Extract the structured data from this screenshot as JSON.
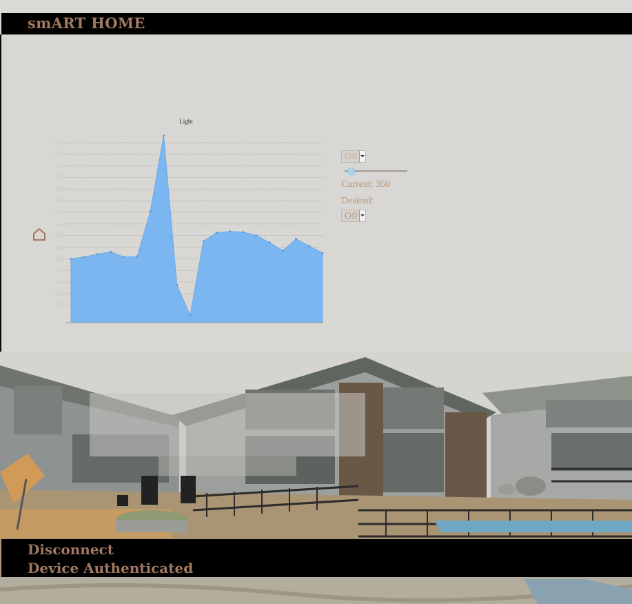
{
  "header": {
    "brand": "smART HOME"
  },
  "icons": {
    "home": "home-icon"
  },
  "colors": {
    "brand_text": "#a0785f",
    "header_bg": "#000000",
    "page_bg": "#d9d7d3",
    "area_fill": "#7cb6f1",
    "control_text": "#b49478"
  },
  "light_panel": {
    "mode_select": {
      "value": "Off"
    },
    "slider_level": 0.04,
    "current_label": "Current: 350",
    "desired_label": "Desired:",
    "desired_select": {
      "value": "Off"
    }
  },
  "chart_data": {
    "type": "area",
    "title": "Light",
    "xlabel": "",
    "ylabel": "",
    "ylim": [
      230,
      560
    ],
    "grid": true,
    "yticks": [
      260,
      280,
      300,
      320,
      340,
      360,
      380,
      400,
      420,
      440,
      460,
      480,
      500,
      520,
      540
    ],
    "series": [
      {
        "values": [
          340,
          343,
          348,
          352,
          343,
          344,
          422,
          552,
          295,
          243,
          370,
          385,
          387,
          386,
          380,
          368,
          354,
          374,
          362,
          350
        ]
      }
    ]
  },
  "footer": {
    "disconnect": "Disconnect",
    "status": "Device Authenticated"
  }
}
